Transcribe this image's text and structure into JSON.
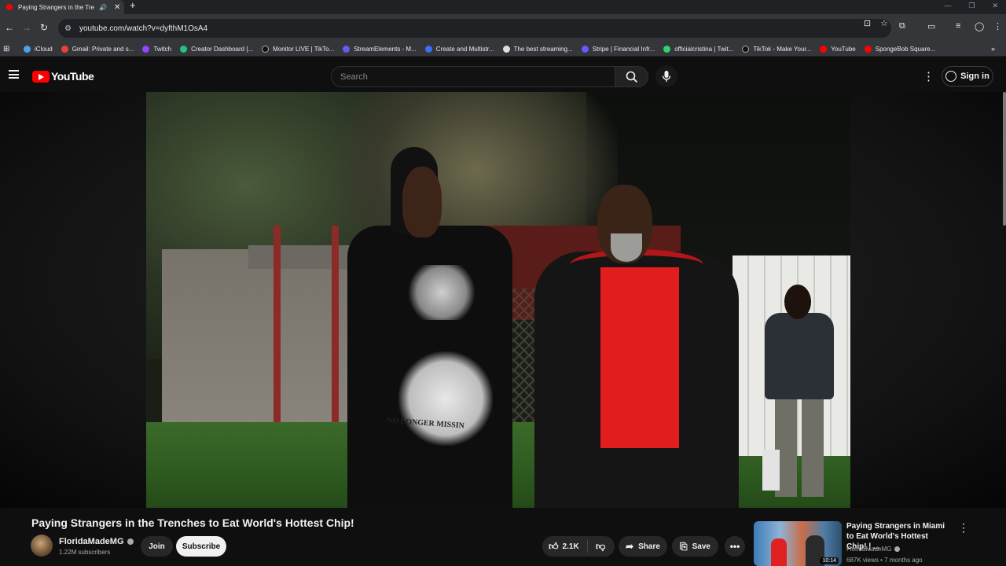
{
  "browser": {
    "tab_title": "Paying Strangers in the Trer",
    "new_tab": "+",
    "close_tab": "✕",
    "url": "youtube.com/watch?v=dyfthM1OsA4",
    "bookmarks": [
      {
        "label": "iCloud",
        "color": "#4aa3f0"
      },
      {
        "label": "Gmail: Private and s...",
        "color": "#ea4335"
      },
      {
        "label": "Twitch",
        "color": "#9146ff"
      },
      {
        "label": "Creator Dashboard |...",
        "color": "#26c281"
      },
      {
        "label": "Monitor LIVE | TikTo...",
        "color": "#111111"
      },
      {
        "label": "StreamElements - M...",
        "color": "#5f5ff5"
      },
      {
        "label": "Create and Multistr...",
        "color": "#3b6ff5"
      },
      {
        "label": "The best streaming...",
        "color": "#dddddd"
      },
      {
        "label": "Stripe | Financial Infr...",
        "color": "#635bff"
      },
      {
        "label": "officialcristina | Twit...",
        "color": "#2fd36b"
      },
      {
        "label": "TikTok - Make Your...",
        "color": "#111111"
      },
      {
        "label": "YouTube",
        "color": "#ff0000"
      },
      {
        "label": "SpongeBob Square...",
        "color": "#ff0000"
      }
    ]
  },
  "youtube": {
    "logo_text": "YouTube",
    "search_placeholder": "Search",
    "sign_in": "Sign in",
    "video": {
      "title": "Paying Strangers in the Trenches to Eat World's Hottest Chip!",
      "channel": "FloridaMadeMG",
      "subscribers": "1.22M subscribers",
      "join": "Join",
      "subscribe": "Subscribe",
      "likes": "2.1K",
      "share": "Share",
      "save": "Save",
      "shirt_text": "NO LONGER MISSIN"
    },
    "recommended": {
      "title": "Paying Strangers in Miami to Eat World's Hottest Chip! | ...",
      "channel": "FloridaMadeMG",
      "meta": "687K views • 7 months ago",
      "duration": "10:14"
    }
  }
}
